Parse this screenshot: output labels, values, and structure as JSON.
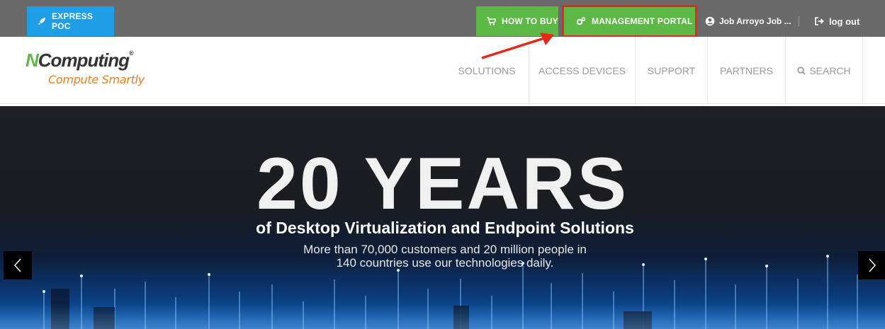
{
  "topbar": {
    "express_poc": "EXPRESS POC",
    "how_to_buy": "HOW TO BUY",
    "management_portal": "MANAGEMENT PORTAL",
    "user_name": "Job Arroyo Job ...",
    "log_out": "log out"
  },
  "logo": {
    "brand_letter": "N",
    "brand_rest": "Computing",
    "registered": "®",
    "tagline": "Compute Smartly"
  },
  "nav": {
    "items": [
      "SOLUTIONS",
      "ACCESS DEVICES",
      "SUPPORT",
      "PARTNERS"
    ],
    "search": "SEARCH"
  },
  "hero": {
    "title": "20 YEARS",
    "subtitle": "of Desktop Virtualization and Endpoint Solutions",
    "desc_line1": "More than 70,000 customers and 20 million people in",
    "desc_line2": "140 countries use our technologies daily."
  },
  "colors": {
    "topbar_bg": "#6a6a6a",
    "poc_blue": "#1f9ee6",
    "buy_green": "#5db946",
    "highlight_red": "#e8271a",
    "logo_orange": "#f07c1a"
  },
  "icons": {
    "poc": "rocket-icon",
    "buy": "cart-icon",
    "portal": "gears-icon",
    "user": "user-circle-icon",
    "logout": "sign-out-icon",
    "search": "search-icon",
    "prev": "chevron-left-icon",
    "next": "chevron-right-icon"
  }
}
